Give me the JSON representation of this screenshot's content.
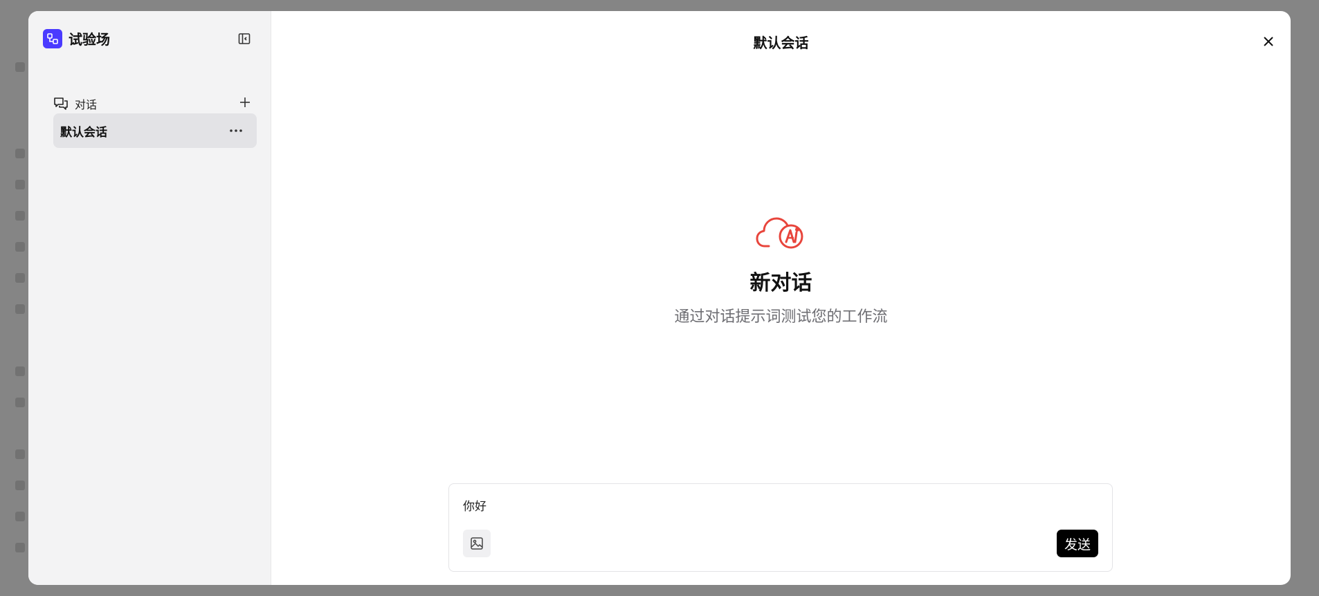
{
  "sidebar": {
    "brand_title": "试验场",
    "section_label": "对话",
    "conversations": [
      {
        "label": "默认会话"
      }
    ]
  },
  "main": {
    "title": "默认会话",
    "empty_title": "新对话",
    "empty_subtitle": "通过对话提示词测试您的工作流"
  },
  "composer": {
    "input_value": "你好",
    "send_label": "发送"
  },
  "colors": {
    "brand_accent": "#4a3aff",
    "logo_red": "#e8453c",
    "send_bg": "#000000"
  },
  "icons": {
    "brand": "workflow-icon",
    "collapse": "sidebar-collapse-icon",
    "chat": "chat-bubbles-icon",
    "add": "plus-icon",
    "more": "more-horizontal-icon",
    "close": "close-icon",
    "image": "image-icon",
    "logo": "cloud-logo-icon"
  }
}
